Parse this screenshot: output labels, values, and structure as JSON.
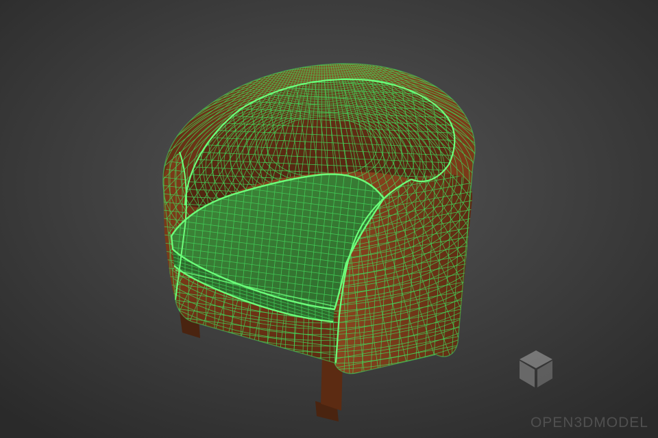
{
  "scene": {
    "subject": "armchair-wireframe",
    "colors": {
      "background_center": "#555555",
      "background_edge": "#2a2a2a",
      "surface_dark": "#5c2b12",
      "surface_mid": "#7a3a18",
      "surface_light": "#8a4620",
      "cushion_fill": "#2e6a2c",
      "cushion_light": "#3f8a3a",
      "wire": "#43d65c",
      "wire_bright": "#6cff7a",
      "feet": "#4a2410"
    }
  },
  "watermark": {
    "text": "OPEN3DMODEL",
    "icon": "cube-icon",
    "color": "#505050",
    "icon_color": "#7a7a7a"
  }
}
